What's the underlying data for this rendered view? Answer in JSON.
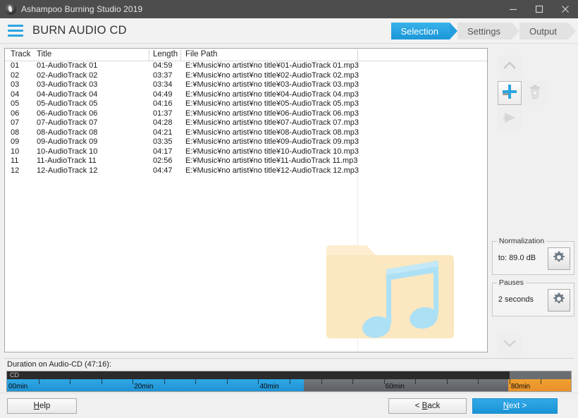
{
  "window": {
    "title": "Ashampoo Burning Studio 2019",
    "app_icon": "flame-icon",
    "minimize_icon": "minimize-icon",
    "maximize_icon": "maximize-icon",
    "close_icon": "close-icon"
  },
  "header": {
    "menu_icon": "hamburger-icon",
    "page_title": "BURN AUDIO CD",
    "breadcrumb": [
      {
        "label": "Selection",
        "active": true
      },
      {
        "label": "Settings",
        "active": false
      },
      {
        "label": "Output",
        "active": false
      }
    ]
  },
  "track_list": {
    "columns": [
      "Track",
      "Title",
      "Length",
      "File Path"
    ],
    "rows": [
      {
        "track": "01",
        "title": "01-AudioTrack 01",
        "length": "04:59",
        "path": "E:¥Music¥no artist¥no title¥01-AudioTrack 01.mp3"
      },
      {
        "track": "02",
        "title": "02-AudioTrack 02",
        "length": "03:37",
        "path": "E:¥Music¥no artist¥no title¥02-AudioTrack 02.mp3"
      },
      {
        "track": "03",
        "title": "03-AudioTrack 03",
        "length": "03:34",
        "path": "E:¥Music¥no artist¥no title¥03-AudioTrack 03.mp3"
      },
      {
        "track": "04",
        "title": "04-AudioTrack 04",
        "length": "04:49",
        "path": "E:¥Music¥no artist¥no title¥04-AudioTrack 04.mp3"
      },
      {
        "track": "05",
        "title": "05-AudioTrack 05",
        "length": "04:16",
        "path": "E:¥Music¥no artist¥no title¥05-AudioTrack 05.mp3"
      },
      {
        "track": "06",
        "title": "06-AudioTrack 06",
        "length": "01:37",
        "path": "E:¥Music¥no artist¥no title¥06-AudioTrack 06.mp3"
      },
      {
        "track": "07",
        "title": "07-AudioTrack 07",
        "length": "04:28",
        "path": "E:¥Music¥no artist¥no title¥07-AudioTrack 07.mp3"
      },
      {
        "track": "08",
        "title": "08-AudioTrack 08",
        "length": "04:21",
        "path": "E:¥Music¥no artist¥no title¥08-AudioTrack 08.mp3"
      },
      {
        "track": "09",
        "title": "09-AudioTrack 09",
        "length": "03:35",
        "path": "E:¥Music¥no artist¥no title¥09-AudioTrack 09.mp3"
      },
      {
        "track": "10",
        "title": "10-AudioTrack 10",
        "length": "04:17",
        "path": "E:¥Music¥no artist¥no title¥10-AudioTrack 10.mp3"
      },
      {
        "track": "11",
        "title": "11-AudioTrack 11",
        "length": "02:56",
        "path": "E:¥Music¥no artist¥no title¥11-AudioTrack 11.mp3"
      },
      {
        "track": "12",
        "title": "12-AudioTrack 12",
        "length": "04:47",
        "path": "E:¥Music¥no artist¥no title¥12-AudioTrack 12.mp3"
      }
    ],
    "illustration": "music-folder-icon"
  },
  "sidebar": {
    "move_up_icon": "chevron-up-icon",
    "add_icon": "add-plus-icon",
    "delete_icon": "trash-icon",
    "play_icon": "play-icon",
    "move_down_icon": "chevron-down-icon",
    "normalization": {
      "label": "Normalization",
      "value": "to: 89.0 dB",
      "settings_icon": "gear-icon"
    },
    "pauses": {
      "label": "Pauses",
      "value": "2 seconds",
      "settings_icon": "gear-icon"
    }
  },
  "duration": {
    "label": "Duration on Audio-CD (47:16):",
    "media_label": "CD",
    "used_minutes": 47.27,
    "capacity_minutes": 80,
    "axis_max_minutes": 90,
    "tick_labels": [
      "00min",
      "20min",
      "40min",
      "60min",
      "80min"
    ],
    "colors": {
      "used": "#2aa2e2",
      "free": "#6a6e73",
      "overburn": "#ed9a2d",
      "media": "#2b2b2b"
    }
  },
  "footer": {
    "help_label": "Help",
    "help_accel": "H",
    "back_label": "Back",
    "back_accel": "B",
    "next_label": "Next",
    "next_accel": "N"
  }
}
